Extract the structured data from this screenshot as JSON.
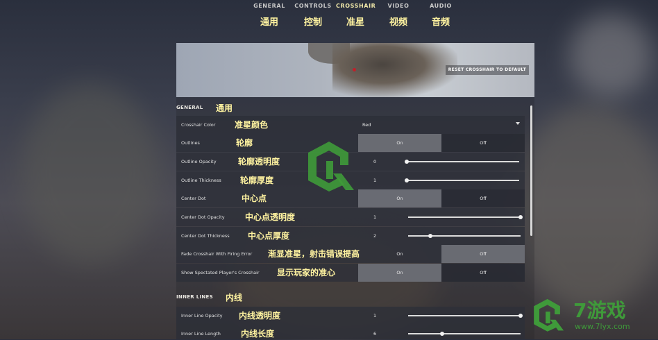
{
  "tabs": [
    {
      "label": "GENERAL",
      "zh": "通用"
    },
    {
      "label": "CONTROLS",
      "zh": "控制"
    },
    {
      "label": "CROSSHAIR",
      "zh": "准星",
      "active": true
    },
    {
      "label": "VIDEO",
      "zh": "视频"
    },
    {
      "label": "AUDIO",
      "zh": "音频"
    }
  ],
  "preview": {
    "reset_label": "RESET CROSSHAIR TO DEFAULT",
    "crosshair_color": "#c0202a"
  },
  "sections": {
    "general": {
      "title": "GENERAL",
      "zh": "通用"
    },
    "inner_lines": {
      "title": "INNER LINES",
      "zh": "内线"
    }
  },
  "rows": {
    "crosshair_color": {
      "label": "Crosshair Color",
      "zh": "准星颜色",
      "value": "Red"
    },
    "outlines": {
      "label": "Outlines",
      "zh": "轮廓",
      "on": "On",
      "off": "Off",
      "selected": "On"
    },
    "outline_opacity": {
      "label": "Outline Opacity",
      "zh": "轮廓透明度",
      "value": "0",
      "fraction": 0
    },
    "outline_thickness": {
      "label": "Outline Thickness",
      "zh": "轮廓厚度",
      "value": "1",
      "fraction": 0
    },
    "center_dot": {
      "label": "Center Dot",
      "zh": "中心点",
      "on": "On",
      "off": "Off",
      "selected": "On"
    },
    "center_dot_opacity": {
      "label": "Center Dot Opacity",
      "zh": "中心点透明度",
      "value": "1",
      "fraction": 1
    },
    "center_dot_thickness": {
      "label": "Center Dot Thickness",
      "zh": "中心点厚度",
      "value": "2",
      "fraction": 0.2
    },
    "fade_crosshair": {
      "label": "Fade Crosshair With Firing Error",
      "zh": "渐显准星，射击错误提高",
      "on": "On",
      "off": "Off",
      "selected": "Off"
    },
    "show_spectated": {
      "label": "Show Spectated Player's Crosshair",
      "zh": "显示玩家的准心",
      "on": "On",
      "off": "Off",
      "selected": "On"
    },
    "inner_line_opacity": {
      "label": "Inner Line Opacity",
      "zh": "内线透明度",
      "value": "1",
      "fraction": 1
    },
    "inner_line_length": {
      "label": "Inner Line Length",
      "zh": "内线长度",
      "value": "6",
      "fraction": 0.3
    }
  },
  "watermark": {
    "brand": "7游戏",
    "url": "www.7lyx.com",
    "color": "#3f9a3a"
  }
}
